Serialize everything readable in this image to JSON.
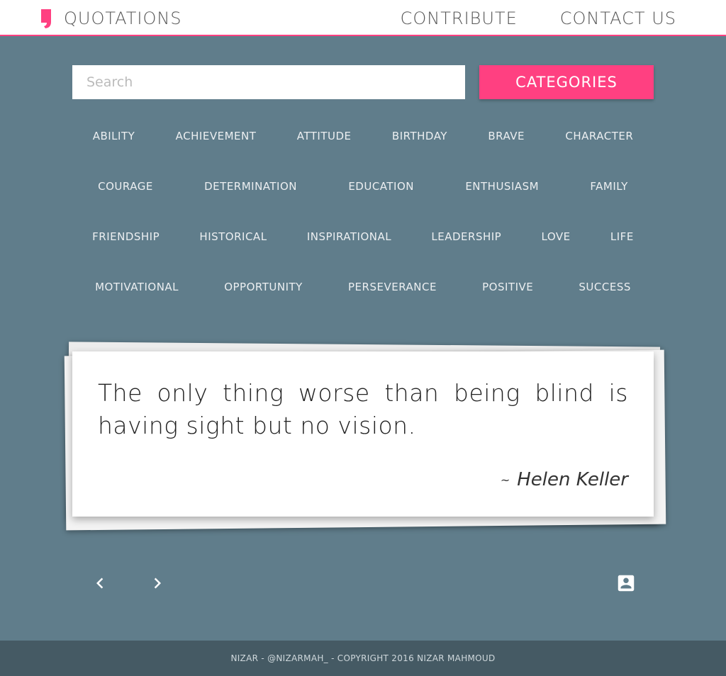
{
  "header": {
    "brand_title": "QUOTATIONS",
    "nav": [
      "CONTRIBUTE",
      "CONTACT US"
    ]
  },
  "search": {
    "placeholder": "Search",
    "value": ""
  },
  "categories_button": "CATEGORIES",
  "categories": [
    [
      "ABILITY",
      "ACHIEVEMENT",
      "ATTITUDE",
      "BIRTHDAY",
      "BRAVE",
      "CHARACTER"
    ],
    [
      "COURAGE",
      "DETERMINATION",
      "EDUCATION",
      "ENTHUSIASM",
      "FAMILY"
    ],
    [
      "FRIENDSHIP",
      "HISTORICAL",
      "INSPIRATIONAL",
      "LEADERSHIP",
      "LOVE",
      "LIFE"
    ],
    [
      "MOTIVATIONAL",
      "OPPORTUNITY",
      "PERSEVERANCE",
      "POSITIVE",
      "SUCCESS"
    ]
  ],
  "quote": {
    "text": "The only thing worse than being blind is having sight but no vision.",
    "tilde": "~",
    "author": "Helen Keller"
  },
  "controls": {
    "prev_icon": "chevron-left-icon",
    "next_icon": "chevron-right-icon",
    "author_icon": "account-box-icon"
  },
  "footer": {
    "text": "NIZAR - @NIZARMAH_ - COPYRIGHT 2016 NIZAR MAHMOUD"
  },
  "colors": {
    "background": "#607d8b",
    "accent": "#ff4081",
    "footer": "#455a64"
  }
}
